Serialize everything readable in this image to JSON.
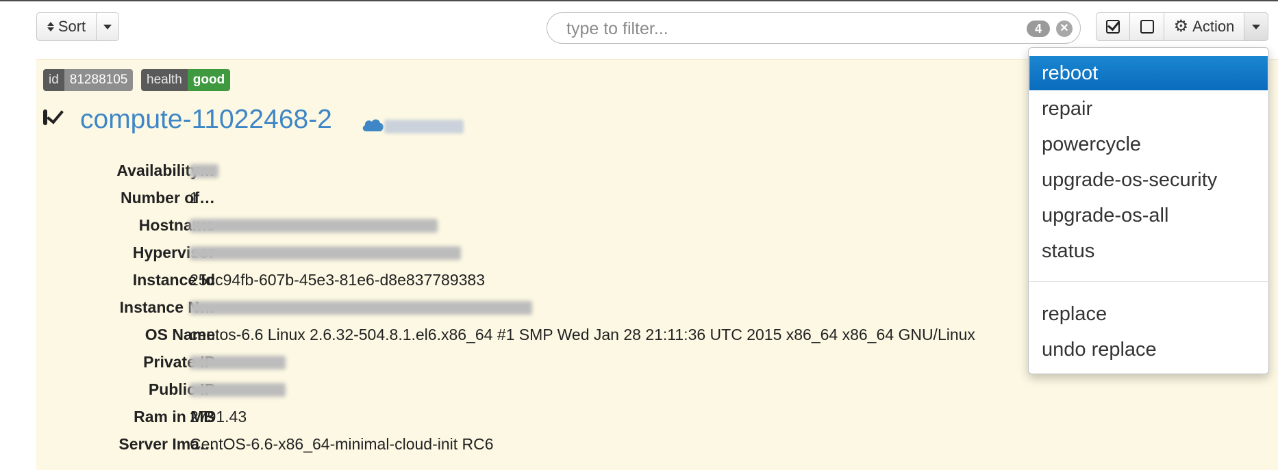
{
  "toolbar": {
    "sort_label": "Sort",
    "filter_placeholder": "type to filter...",
    "filter_count": "4",
    "action_label": "Action"
  },
  "item": {
    "labels": [
      {
        "key": "id",
        "value": "81288105"
      },
      {
        "key": "health",
        "value": "good"
      }
    ],
    "title": "compute-11022468-2",
    "properties": [
      {
        "key": "Availability…",
        "value": "",
        "redacted": true
      },
      {
        "key": "Number of…",
        "value": "1",
        "redacted": false
      },
      {
        "key": "Hostname",
        "value": "",
        "redacted": true
      },
      {
        "key": "Hypervisor",
        "value": "",
        "redacted": true
      },
      {
        "key": "Instance Id",
        "value": "25cc94fb-607b-45e3-81e6-d8e837789383",
        "redacted": false
      },
      {
        "key": "Instance N…",
        "value": "",
        "redacted": true
      },
      {
        "key": "OS Name",
        "value": "centos-6.6 Linux 2.6.32-504.8.1.el6.x86_64 #1 SMP Wed Jan 28 21:11:36 UTC 2015 x86_64 x86_64 GNU/Linux",
        "redacted": false
      },
      {
        "key": "Private IP",
        "value": "",
        "redacted": true
      },
      {
        "key": "Public IP",
        "value": "",
        "redacted": true
      },
      {
        "key": "Ram in MB",
        "value": "2791.43",
        "redacted": false
      },
      {
        "key": "Server Ima…",
        "value": "CentOS-6.6-x86_64-minimal-cloud-init RC6",
        "redacted": false
      }
    ]
  },
  "action_menu": {
    "items": [
      "reboot",
      "repair",
      "powercycle",
      "upgrade-os-security",
      "upgrade-os-all",
      "status"
    ],
    "secondary_items": [
      "replace",
      "undo replace"
    ],
    "active_item": "reboot"
  },
  "colors": {
    "card_background": "#fcf8e3",
    "title": "#3e86c5",
    "health_good": "#3f9a3f",
    "menu_active": "#0a6cbd"
  },
  "icons": [
    "sort-icon",
    "caret-down-icon",
    "clear-icon",
    "check-all-icon",
    "uncheck-all-icon",
    "gear-icon",
    "checkbox-checked-icon",
    "cloud-icon"
  ]
}
